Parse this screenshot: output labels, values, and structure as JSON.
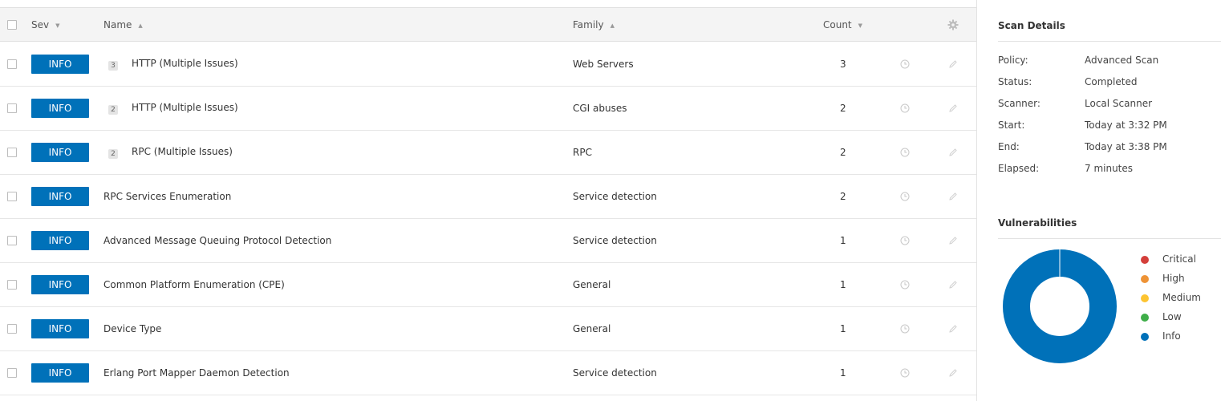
{
  "table": {
    "headers": {
      "sev": "Sev",
      "name": "Name",
      "family": "Family",
      "count": "Count"
    },
    "rows": [
      {
        "severity": "INFO",
        "group_count": "3",
        "name": "HTTP (Multiple Issues)",
        "family": "Web Servers",
        "count": "3"
      },
      {
        "severity": "INFO",
        "group_count": "2",
        "name": "HTTP (Multiple Issues)",
        "family": "CGI abuses",
        "count": "2"
      },
      {
        "severity": "INFO",
        "group_count": "2",
        "name": "RPC (Multiple Issues)",
        "family": "RPC",
        "count": "2"
      },
      {
        "severity": "INFO",
        "group_count": null,
        "name": "RPC Services Enumeration",
        "family": "Service detection",
        "count": "2"
      },
      {
        "severity": "INFO",
        "group_count": null,
        "name": "Advanced Message Queuing Protocol Detection",
        "family": "Service detection",
        "count": "1"
      },
      {
        "severity": "INFO",
        "group_count": null,
        "name": "Common Platform Enumeration (CPE)",
        "family": "General",
        "count": "1"
      },
      {
        "severity": "INFO",
        "group_count": null,
        "name": "Device Type",
        "family": "General",
        "count": "1"
      },
      {
        "severity": "INFO",
        "group_count": null,
        "name": "Erlang Port Mapper Daemon Detection",
        "family": "Service detection",
        "count": "1"
      }
    ]
  },
  "scan_details": {
    "title": "Scan Details",
    "items": [
      {
        "label": "Policy:",
        "value": "Advanced Scan"
      },
      {
        "label": "Status:",
        "value": "Completed"
      },
      {
        "label": "Scanner:",
        "value": "Local Scanner"
      },
      {
        "label": "Start:",
        "value": "Today at 3:32 PM"
      },
      {
        "label": "End:",
        "value": "Today at 3:38 PM"
      },
      {
        "label": "Elapsed:",
        "value": "7 minutes"
      }
    ]
  },
  "vulnerabilities": {
    "title": "Vulnerabilities",
    "legend": [
      {
        "label": "Critical",
        "color": "#d43f3a"
      },
      {
        "label": "High",
        "color": "#ee9336"
      },
      {
        "label": "Medium",
        "color": "#fdc431"
      },
      {
        "label": "Low",
        "color": "#3fae49"
      },
      {
        "label": "Info",
        "color": "#0071b9"
      }
    ]
  },
  "chart_data": {
    "type": "pie",
    "categories": [
      "Critical",
      "High",
      "Medium",
      "Low",
      "Info"
    ],
    "values": [
      0,
      0,
      0,
      0,
      1
    ],
    "colors": [
      "#d43f3a",
      "#ee9336",
      "#fdc431",
      "#3fae49",
      "#0071b9"
    ],
    "donut": true
  },
  "icons": {
    "settings": "gear-icon",
    "row_action_1": "clock-icon",
    "row_action_2": "pencil-icon"
  }
}
